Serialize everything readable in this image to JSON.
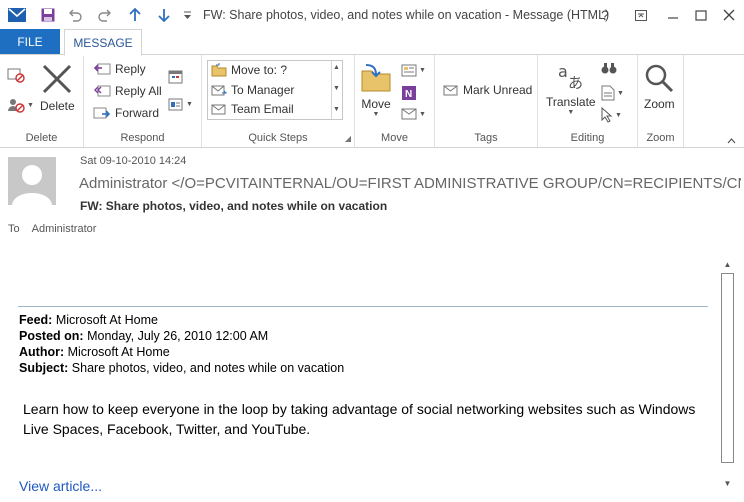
{
  "window": {
    "title": "FW: Share photos, video, and notes while on vacation - Message (HTML)"
  },
  "tabs": {
    "file": "FILE",
    "message": "MESSAGE"
  },
  "ribbon": {
    "delete": {
      "button": "Delete",
      "group": "Delete"
    },
    "respond": {
      "reply": "Reply",
      "reply_all": "Reply All",
      "forward": "Forward",
      "group": "Respond"
    },
    "quick_steps": {
      "items": [
        "Move to: ?",
        "To Manager",
        "Team Email"
      ],
      "group": "Quick Steps"
    },
    "move": {
      "button": "Move",
      "group": "Move"
    },
    "tags": {
      "mark_unread": "Mark Unread",
      "group": "Tags"
    },
    "editing": {
      "translate": "Translate",
      "group": "Editing"
    },
    "zoom": {
      "button": "Zoom",
      "group": "Zoom"
    }
  },
  "message": {
    "date": "Sat 09-10-2010 14:24",
    "from": "Administrator </O=PCVITAINTERNAL/OU=FIRST ADMINISTRATIVE GROUP/CN=RECIPIENTS/CN=ADMINISTRATOR>",
    "subject": "FW: Share photos, video, and notes while on vacation",
    "to_label": "To",
    "to_name": "Administrator"
  },
  "body": {
    "feed_label": "Feed:",
    "feed": "Microsoft At Home",
    "posted_label": "Posted on:",
    "posted": "Monday, July 26, 2010 12:00 AM",
    "author_label": "Author:",
    "author": "Microsoft At Home",
    "subject_label": "Subject:",
    "subject": "Share photos, video, and notes while on vacation",
    "paragraph": "Learn how to keep everyone in the loop by taking advantage of social networking websites such as Windows Live Spaces, Facebook, Twitter, and YouTube.",
    "link": "View article..."
  },
  "colors": {
    "accent": "#1e6fc2",
    "link": "#1f58c4"
  }
}
